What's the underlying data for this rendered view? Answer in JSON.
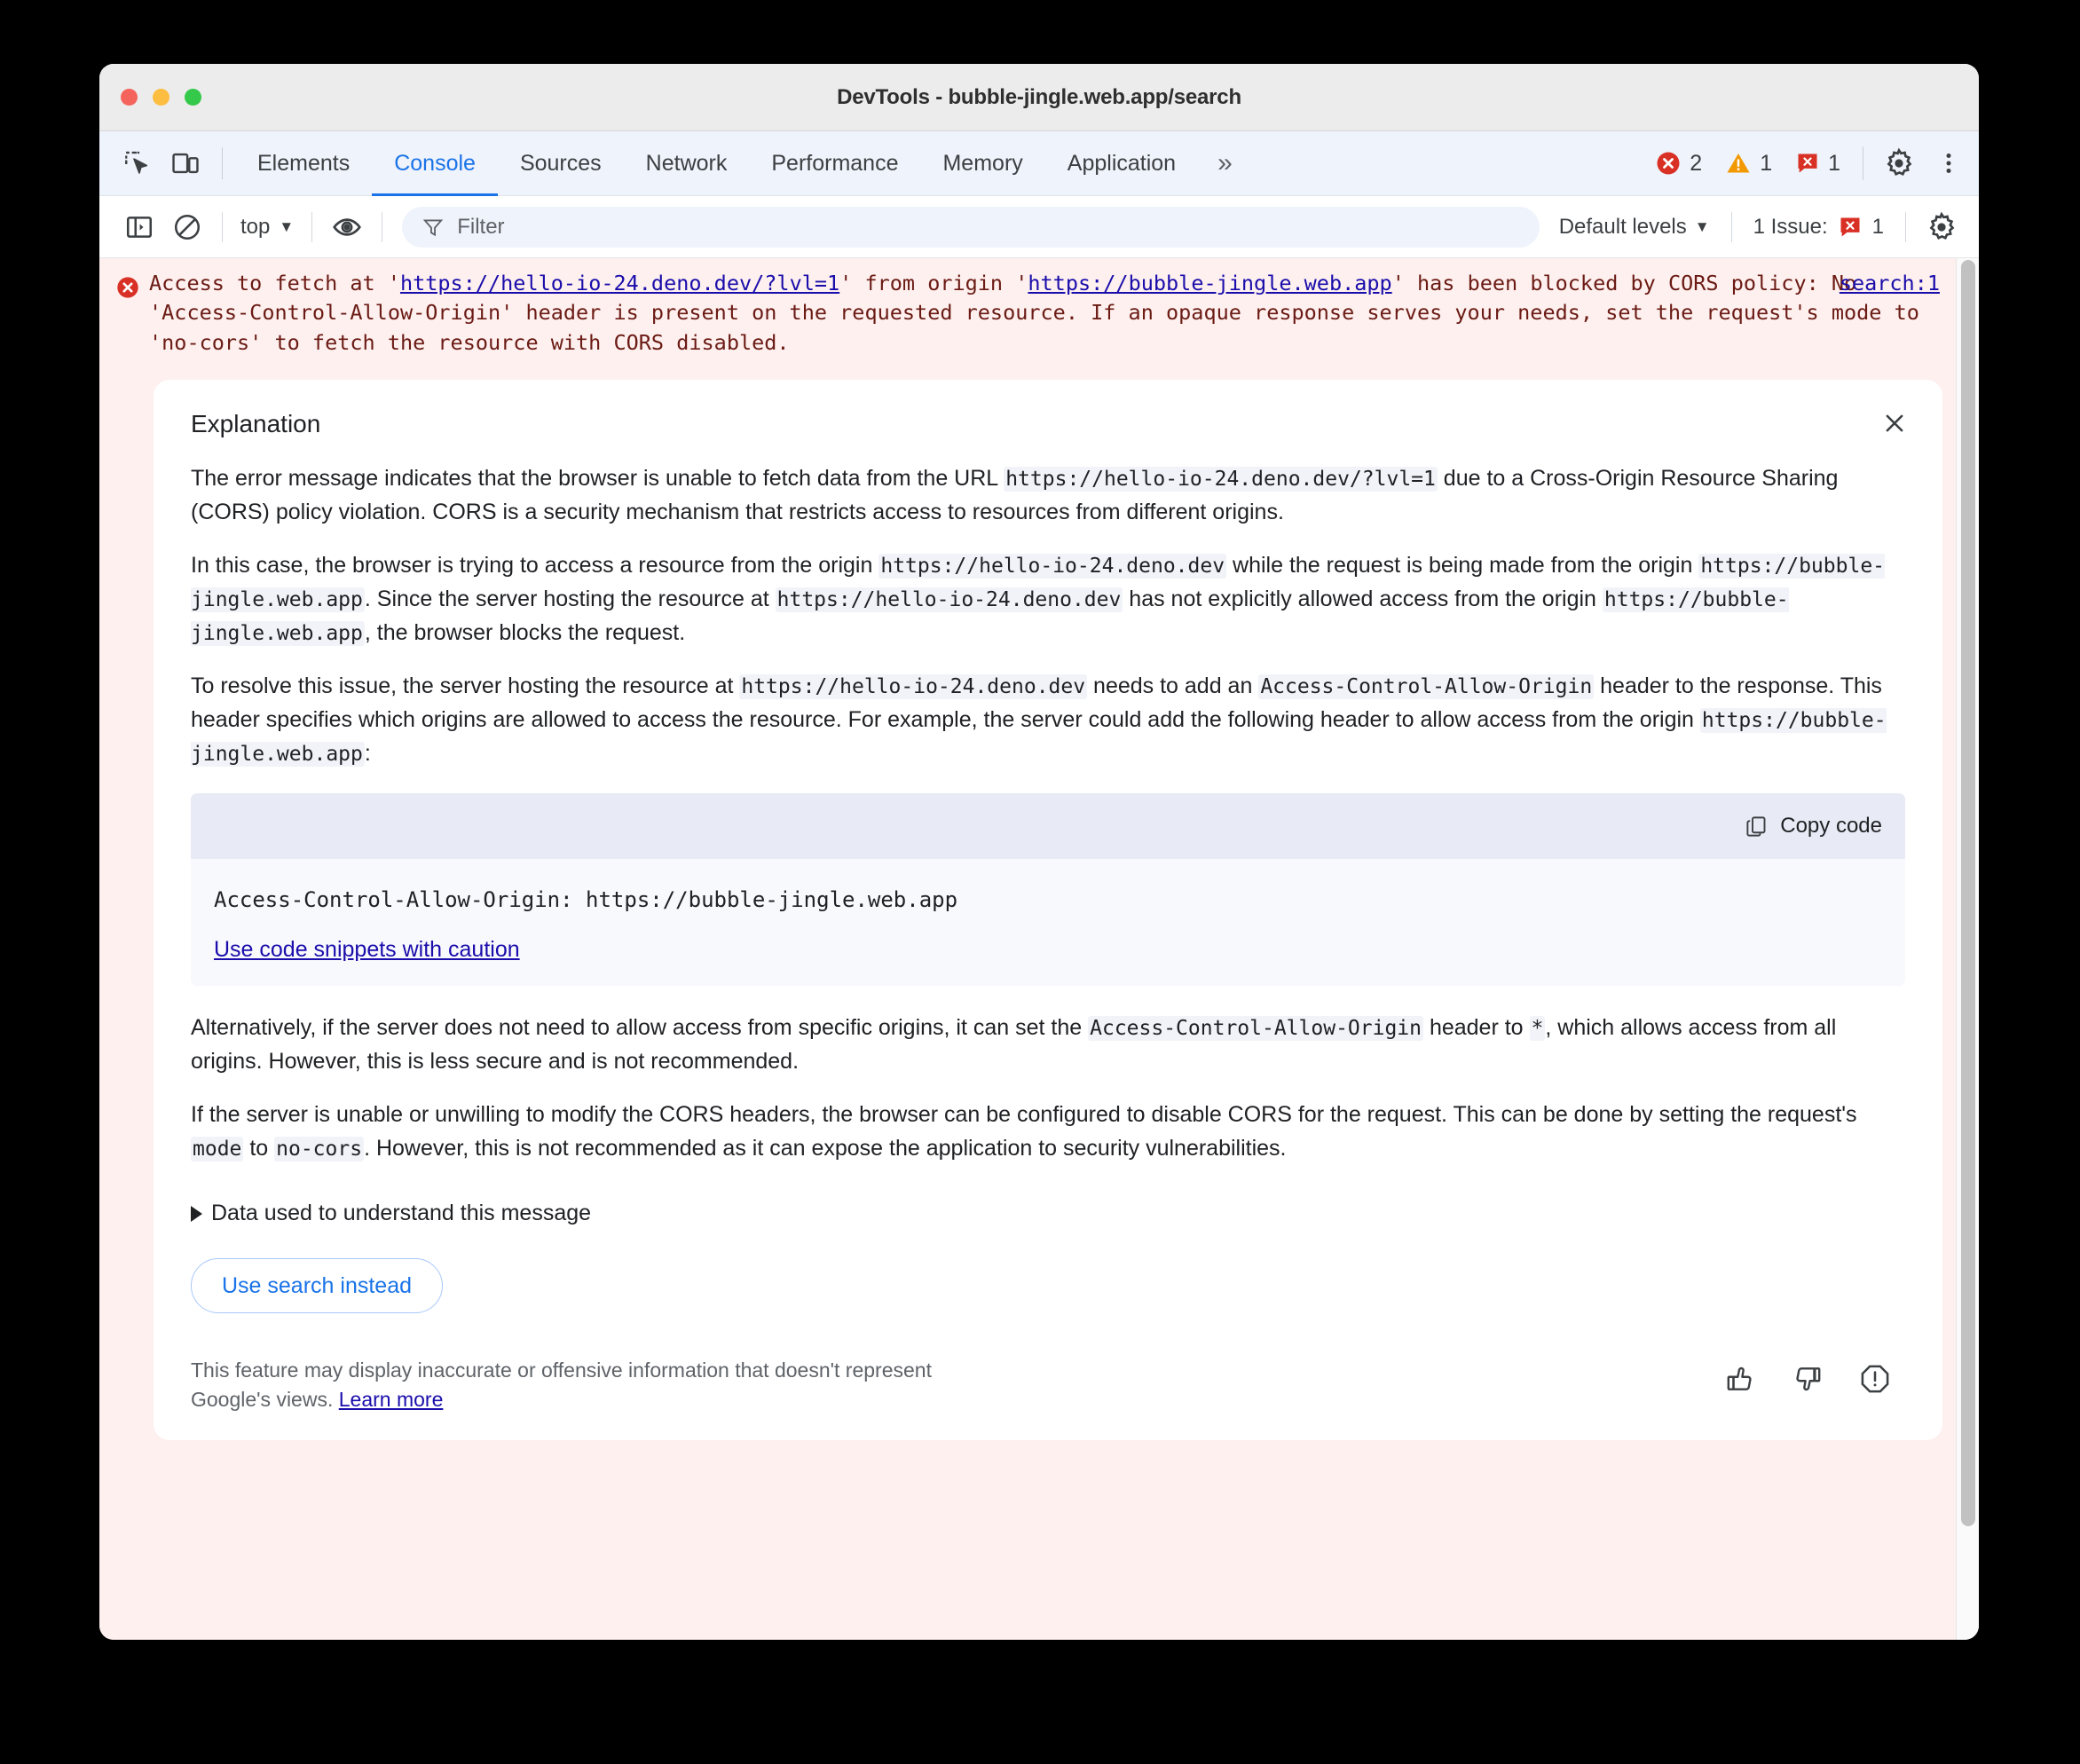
{
  "window": {
    "title": "DevTools - bubble-jingle.web.app/search",
    "traffic_lights": [
      "close",
      "minimize",
      "zoom"
    ]
  },
  "tabbar": {
    "left_icons": [
      {
        "name": "inspect-element-icon"
      },
      {
        "name": "device-toolbar-icon"
      }
    ],
    "tabs": [
      {
        "label": "Elements",
        "active": false
      },
      {
        "label": "Console",
        "active": true
      },
      {
        "label": "Sources",
        "active": false
      },
      {
        "label": "Network",
        "active": false
      },
      {
        "label": "Performance",
        "active": false
      },
      {
        "label": "Memory",
        "active": false
      },
      {
        "label": "Application",
        "active": false
      }
    ],
    "overflow_label": "»",
    "counts": {
      "errors": "2",
      "warnings": "1",
      "issues": "1"
    },
    "settings_icon": "gear-icon",
    "more_icon": "kebab-menu-icon"
  },
  "filterbar": {
    "sidebar_toggle_icon": "console-sidebar-icon",
    "clear_console_icon": "clear-console-icon",
    "context_value": "top",
    "live_expression_icon": "eye-icon",
    "filter_placeholder": "Filter",
    "filter_value": "",
    "levels_label": "Default levels",
    "issues_label": "1 Issue:",
    "issues_count": "1",
    "console_settings_icon": "gear-icon"
  },
  "console": {
    "error": {
      "icon": "error-circle-icon",
      "text_part1": "Access to fetch at '",
      "link1": "https://hello-io-24.deno.dev/?lvl=1",
      "text_part2": "' from origin '",
      "link2": "https://bubble-jingle.web.app",
      "text_part3": "' has been blocked by CORS policy: No 'Access-Control-Allow-Origin' header is present on the requested resource. If an opaque response serves your needs, set the request's mode to 'no-cors' to fetch the resource with CORS disabled.",
      "source_link": "search:1"
    }
  },
  "explanation": {
    "title": "Explanation",
    "close_icon": "close-icon",
    "paragraph1": {
      "a": "The error message indicates that the browser is unable to fetch data from the URL ",
      "code1": "https://hello-io-24.deno.dev/?lvl=1",
      "b": " due to a Cross-Origin Resource Sharing (CORS) policy violation. CORS is a security mechanism that restricts access to resources from different origins."
    },
    "paragraph2": {
      "a": "In this case, the browser is trying to access a resource from the origin ",
      "code1": "https://hello-io-24.deno.dev",
      "b": " while the request is being made from the origin ",
      "code2": "https://bubble-jingle.web.app",
      "c": ". Since the server hosting the resource at ",
      "code3": "https://hello-io-24.deno.dev",
      "d": " has not explicitly allowed access from the origin ",
      "code4": "https://bubble-jingle.web.app",
      "e": ", the browser blocks the request."
    },
    "paragraph3": {
      "a": "To resolve this issue, the server hosting the resource at ",
      "code1": "https://hello-io-24.deno.dev",
      "b": " needs to add an ",
      "code2": "Access-Control-Allow-Origin",
      "c": " header to the response. This header specifies which origins are allowed to access the resource. For example, the server could add the following header to allow access from the origin ",
      "code3": "https://bubble-jingle.web.app",
      "d": ":"
    },
    "code_block": {
      "copy_label": "Copy code",
      "copy_icon": "copy-icon",
      "code": "Access-Control-Allow-Origin: https://bubble-jingle.web.app",
      "caution_link": "Use code snippets with caution"
    },
    "paragraph4": {
      "a": "Alternatively, if the server does not need to allow access from specific origins, it can set the ",
      "code1": "Access-Control-Allow-Origin",
      "b": " header to ",
      "code2": "*",
      "c": ", which allows access from all origins. However, this is less secure and is not recommended."
    },
    "paragraph5": {
      "a": "If the server is unable or unwilling to modify the CORS headers, the browser can be configured to disable CORS for the request. This can be done by setting the request's ",
      "code1": "mode",
      "b": " to ",
      "code2": "no-cors",
      "c": ". However, this is not recommended as it can expose the application to security vulnerabilities."
    },
    "data_disclosure": "Data used to understand this message",
    "use_search_button": "Use search instead",
    "disclaimer_text": "This feature may display inaccurate or offensive information that doesn't represent Google's views. ",
    "disclaimer_link": "Learn more",
    "rate_icons": [
      {
        "name": "thumb-up-icon"
      },
      {
        "name": "thumb-down-icon"
      },
      {
        "name": "report-icon"
      }
    ]
  },
  "colors": {
    "accent": "#1a73e8",
    "link": "#1a0dab",
    "error_bg": "#fdf0ee",
    "error_red": "#d93025",
    "warning_orange": "#f29900"
  }
}
